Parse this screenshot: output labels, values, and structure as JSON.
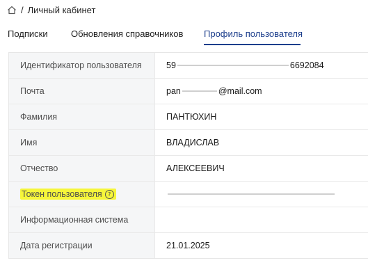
{
  "breadcrumb": {
    "separator": "/",
    "current": "Личный кабинет"
  },
  "tabs": [
    {
      "label": "Подписки"
    },
    {
      "label": "Обновления справочников"
    },
    {
      "label": "Профиль пользователя",
      "active": true
    }
  ],
  "profile": {
    "rows": [
      {
        "label": "Идентификатор пользователя",
        "value_start": "59",
        "value_end": "6692084"
      },
      {
        "label": "Почта",
        "value_start": "pan",
        "value_end": "@mail.com"
      },
      {
        "label": "Фамилия",
        "value": "ПАНТЮХИН"
      },
      {
        "label": "Имя",
        "value": "ВЛАДИСЛАВ"
      },
      {
        "label": "Отчество",
        "value": "АЛЕКСЕЕВИЧ"
      },
      {
        "label": "Токен пользователя",
        "value": ""
      },
      {
        "label": "Информационная система",
        "value": ""
      },
      {
        "label": "Дата регистрации",
        "value": "21.01.2025"
      }
    ]
  },
  "colors": {
    "accent": "#1c3e8c",
    "highlight": "#f6f63a",
    "label_bg": "#f5f6f7"
  }
}
